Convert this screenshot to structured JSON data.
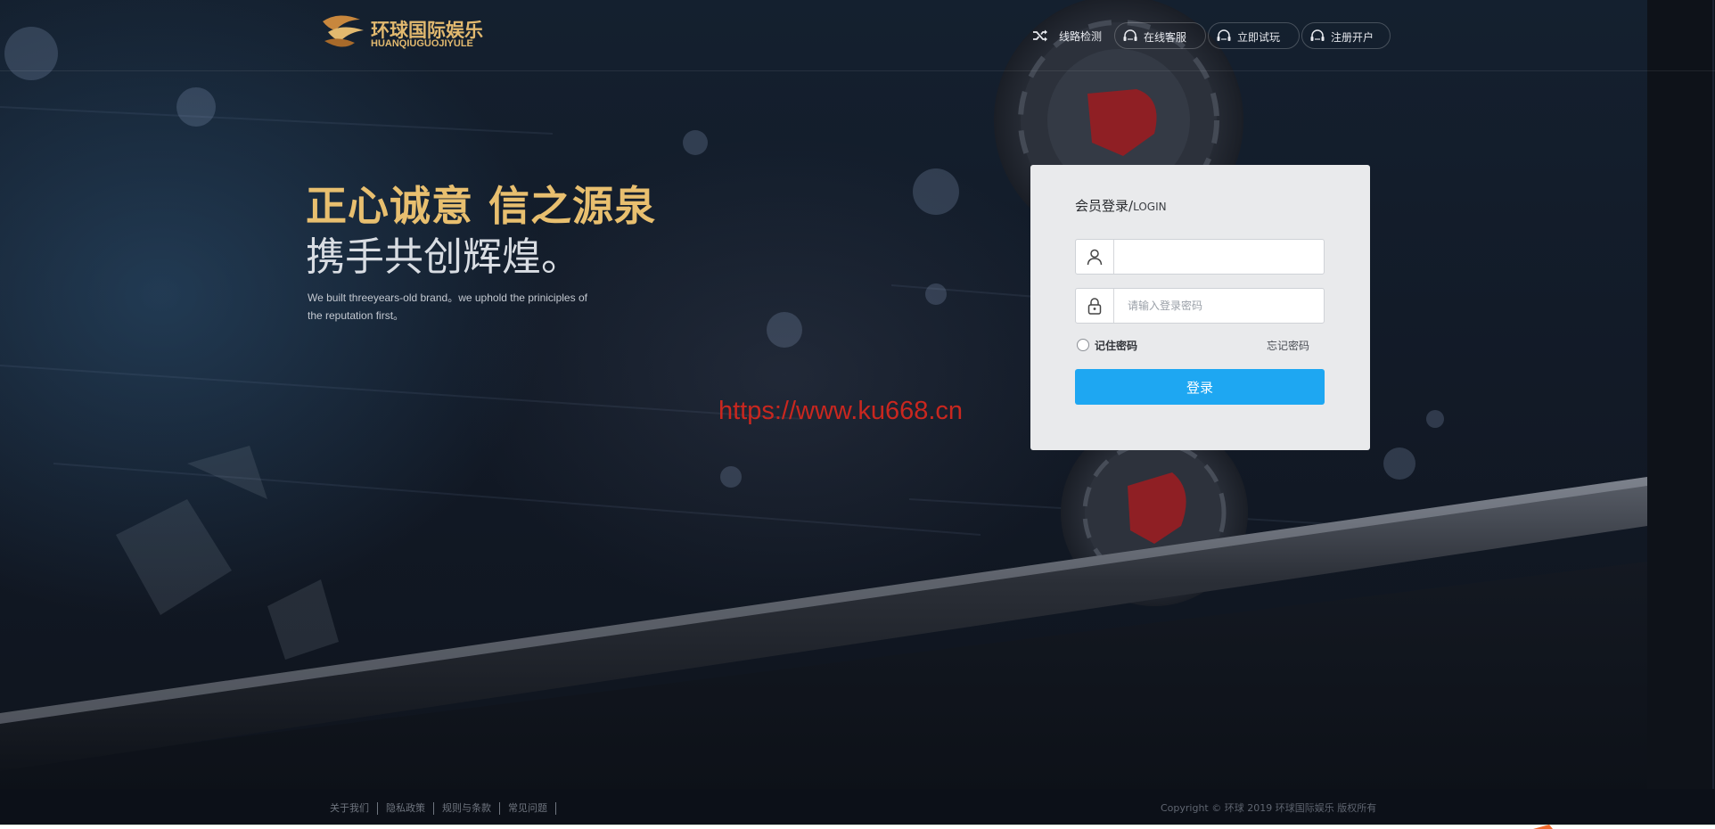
{
  "header": {
    "logo": {
      "name_cn": "环球国际娱乐",
      "name_en": "HUANQIUGUOJIYULE",
      "icon": "brand-swirl-icon",
      "accent_color": "#e2b96f"
    },
    "nav": [
      {
        "label": "线路检测",
        "icon": "shuffle-icon"
      },
      {
        "label": "在线客服",
        "icon": "headset-icon"
      },
      {
        "label": "立即试玩",
        "icon": "headset-icon"
      },
      {
        "label": "注册开户",
        "icon": "headset-icon"
      }
    ]
  },
  "hero": {
    "headline": "正心诚意 信之源泉",
    "subheadline": "携手共创辉煌。",
    "description": "We built threeyears-old brand。we uphold the priniciples of the reputation first。",
    "headline_color": "#e8bf6f"
  },
  "watermark": {
    "text": "https://www.ku668.cn",
    "color": "#c9271f"
  },
  "login": {
    "title": "会员登录/",
    "title_suffix": "LOGIN",
    "username": {
      "value": "",
      "placeholder": "",
      "icon": "user-icon"
    },
    "password": {
      "value": "",
      "placeholder": "请输入登录密码",
      "icon": "lock-icon"
    },
    "remember_label": "记住密码",
    "remember_checked": false,
    "forgot_label": "忘记密码",
    "submit_label": "登录",
    "button_color": "#1ea7f2"
  },
  "footer": {
    "links": [
      "关于我们",
      "隐私政策",
      "规则与条款",
      "常见问题"
    ],
    "copyright": "Copyright © 环球 2019 环球国际娱乐 版权所有"
  }
}
